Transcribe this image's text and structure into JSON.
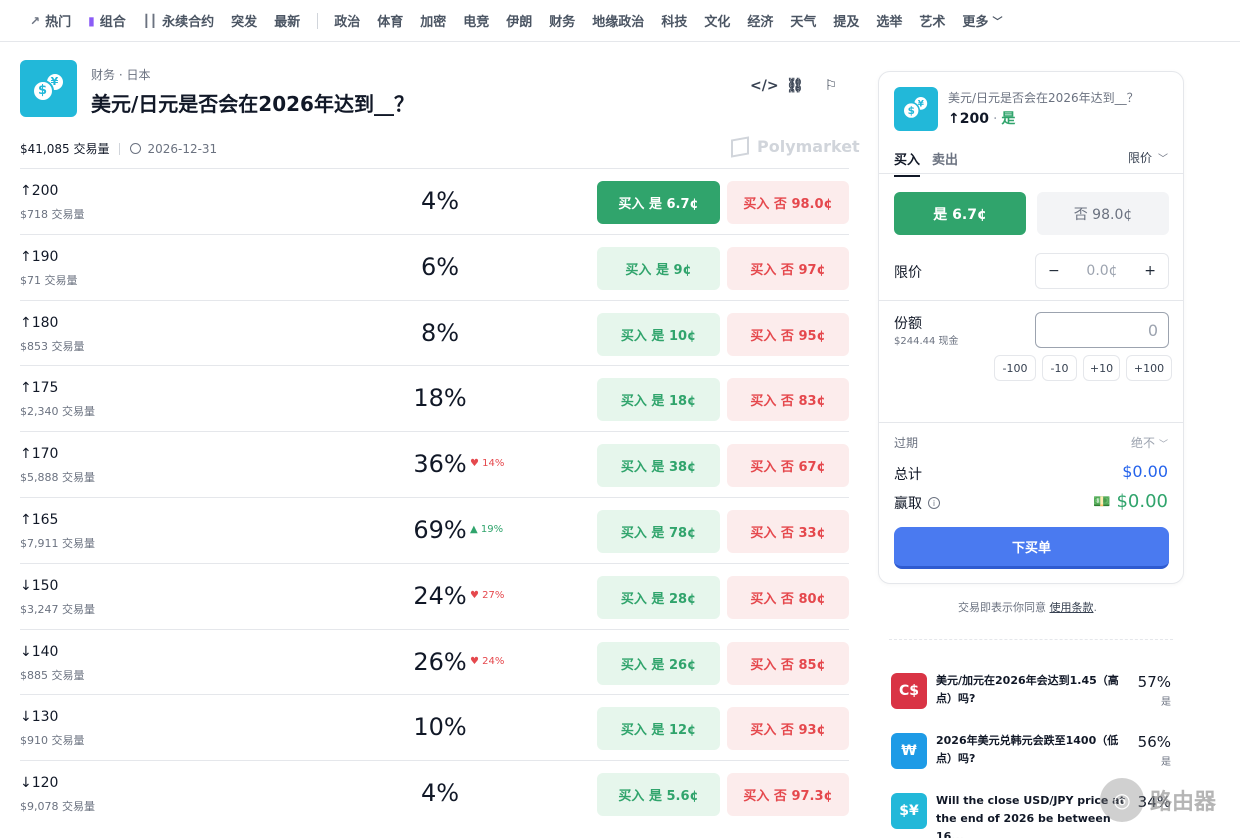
{
  "nav": {
    "items": [
      {
        "label": "热门",
        "icon": "trending-icon"
      },
      {
        "label": "组合",
        "icon": "combo-icon"
      },
      {
        "label": "永续合约",
        "icon": "candlestick-icon"
      },
      {
        "label": "突发"
      },
      {
        "label": "最新"
      }
    ],
    "categories": [
      "政治",
      "体育",
      "加密",
      "电竞",
      "伊朗",
      "财务",
      "地缘政治",
      "科技",
      "文化",
      "经济",
      "天气",
      "提及",
      "选举",
      "艺术"
    ],
    "more": "更多"
  },
  "header": {
    "breadcrumb": "财务 · 日本",
    "title": "美元/日元是否会在2026年达到__？",
    "volume": "$41,085 交易量",
    "date": "2026-12-31",
    "brand": "Polymarket"
  },
  "markets": [
    {
      "label": "↑200",
      "volume": "$718 交易量",
      "pct": "4%",
      "change": "",
      "dir": "",
      "yes": "买入 是 6.7¢",
      "no": "买入 否 98.0¢",
      "active": true
    },
    {
      "label": "↑190",
      "volume": "$71 交易量",
      "pct": "6%",
      "change": "",
      "dir": "",
      "yes": "买入 是 9¢",
      "no": "买入 否 97¢"
    },
    {
      "label": "↑180",
      "volume": "$853 交易量",
      "pct": "8%",
      "change": "",
      "dir": "",
      "yes": "买入 是 10¢",
      "no": "买入 否 95¢"
    },
    {
      "label": "↑175",
      "volume": "$2,340 交易量",
      "pct": "18%",
      "change": "",
      "dir": "",
      "yes": "买入 是 18¢",
      "no": "买入 否 83¢"
    },
    {
      "label": "↑170",
      "volume": "$5,888 交易量",
      "pct": "36%",
      "change": "♥ 14%",
      "dir": "down",
      "yes": "买入 是 38¢",
      "no": "买入 否 67¢"
    },
    {
      "label": "↑165",
      "volume": "$7,911 交易量",
      "pct": "69%",
      "change": "▲ 19%",
      "dir": "up",
      "yes": "买入 是 78¢",
      "no": "买入 否 33¢"
    },
    {
      "label": "↓150",
      "volume": "$3,247 交易量",
      "pct": "24%",
      "change": "♥ 27%",
      "dir": "down",
      "yes": "买入 是 28¢",
      "no": "买入 否 80¢"
    },
    {
      "label": "↓140",
      "volume": "$885 交易量",
      "pct": "26%",
      "change": "♥ 24%",
      "dir": "down",
      "yes": "买入 是 26¢",
      "no": "买入 否 85¢"
    },
    {
      "label": "↓130",
      "volume": "$910 交易量",
      "pct": "10%",
      "change": "",
      "dir": "",
      "yes": "买入 是 12¢",
      "no": "买入 否 93¢"
    },
    {
      "label": "↓120",
      "volume": "$9,078 交易量",
      "pct": "4%",
      "change": "",
      "dir": "",
      "yes": "买入 是 5.6¢",
      "no": "买入 否 97.3¢"
    }
  ],
  "panel": {
    "title": "美元/日元是否会在2026年达到__？",
    "outcome": "↑200",
    "side": "是",
    "tab_buy": "买入",
    "tab_sell": "卖出",
    "order_type": "限价",
    "yes_btn": "是 6.7¢",
    "no_btn": "否 98.0¢",
    "limit_label": "限价",
    "limit_value": "0.0¢",
    "shares_label": "份额",
    "cash": "$244.44 现金",
    "shares_value": "0",
    "quick": [
      "-100",
      "-10",
      "+10",
      "+100"
    ],
    "expiry_label": "过期",
    "expiry_value": "绝不",
    "total_label": "总计",
    "total_value": "$0.00",
    "win_label": "赢取",
    "win_value": "$0.00",
    "buy_button": "下买单"
  },
  "terms": {
    "text": "交易即表示你同意",
    "link": "使用条款"
  },
  "related": [
    {
      "icon_text": "C$",
      "color": "#d93445",
      "text": "美元/加元在2026年会达到1.45（高点）吗?",
      "pct": "57%",
      "side": "是"
    },
    {
      "icon_text": "₩",
      "color": "#1e9be6",
      "text": "2026年美元兑韩元会跌至1400（低点）吗?",
      "pct": "56%",
      "side": "是"
    },
    {
      "icon_text": "$¥",
      "color": "#22b8d9",
      "text": "Will the close USD/JPY price at the end of 2026 be between 16...",
      "pct": "34%",
      "side": ""
    }
  ],
  "watermark": "路由器"
}
